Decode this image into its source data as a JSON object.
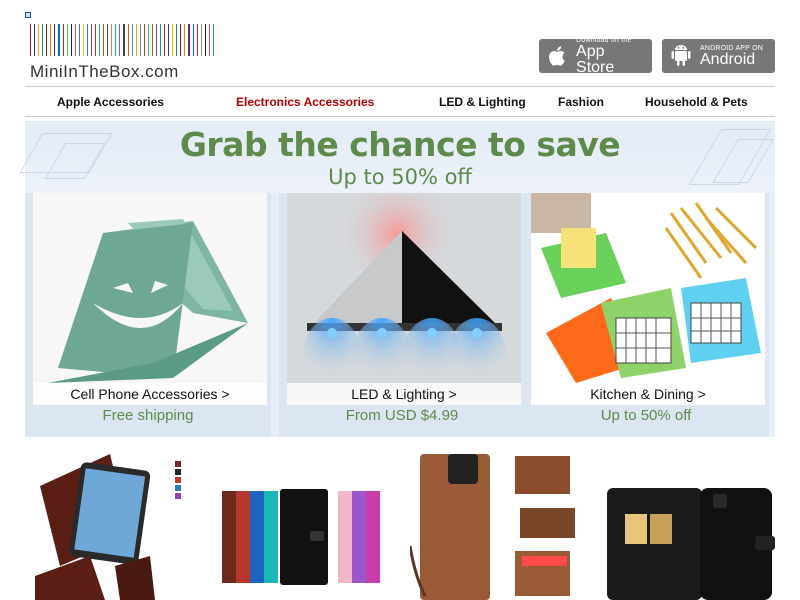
{
  "header": {
    "logo_text": "MiniInTheBox.com",
    "logo_bar_colors": [
      "#c8102e",
      "#1f3f8f",
      "#f2a900",
      "#2e8b57",
      "#8b1a1a",
      "#ff7f00",
      "#5b2c83",
      "#0077c8",
      "#d4145a",
      "#6ab04c",
      "#222222",
      "#e84c3d",
      "#2980b9",
      "#f1c40f",
      "#16a085",
      "#8e44ad",
      "#c0392b",
      "#27ae60",
      "#d35400",
      "#2c3e50",
      "#e67e22",
      "#1abc9c",
      "#9b59b6",
      "#34495e",
      "#e74c3c",
      "#3498db",
      "#f39c12",
      "#7f8c8d",
      "#c0392b",
      "#2ecc71",
      "#d35400",
      "#8e44ad",
      "#16a085",
      "#c8102e",
      "#1f3f8f",
      "#f2a900",
      "#2e8b57",
      "#8b1a1a",
      "#ff7f00",
      "#5b2c83",
      "#0077c8",
      "#d4145a",
      "#6ab04c",
      "#222222",
      "#e84c3d",
      "#2980b9"
    ],
    "appstore": {
      "sub": "Download on the",
      "main": "App Store",
      "icon": "apple-icon"
    },
    "android": {
      "sub": "ANDROID APP ON",
      "main": "Android",
      "icon": "android-icon"
    }
  },
  "nav": {
    "items": [
      {
        "label": "Apple Accessories",
        "active": false
      },
      {
        "label": "Electronics Accessories",
        "active": true
      },
      {
        "label": "LED & Lighting",
        "active": false
      },
      {
        "label": "Fashion",
        "active": false
      },
      {
        "label": "Household & Pets",
        "active": false
      }
    ]
  },
  "banner": {
    "headline": "Grab the chance to save",
    "subline": "Up to 50% off",
    "cards": [
      {
        "caption": "Cell Phone Accessories >",
        "promo": "Free shipping"
      },
      {
        "caption": "LED & Lighting >",
        "promo": "From USD $4.99"
      },
      {
        "caption": "Kitchen & Dining >",
        "promo": "Up to 50% off"
      }
    ]
  },
  "colors": {
    "accent_green": "#5e8a4b",
    "nav_active": "#b30000",
    "banner_bg": "#e6eef8"
  }
}
